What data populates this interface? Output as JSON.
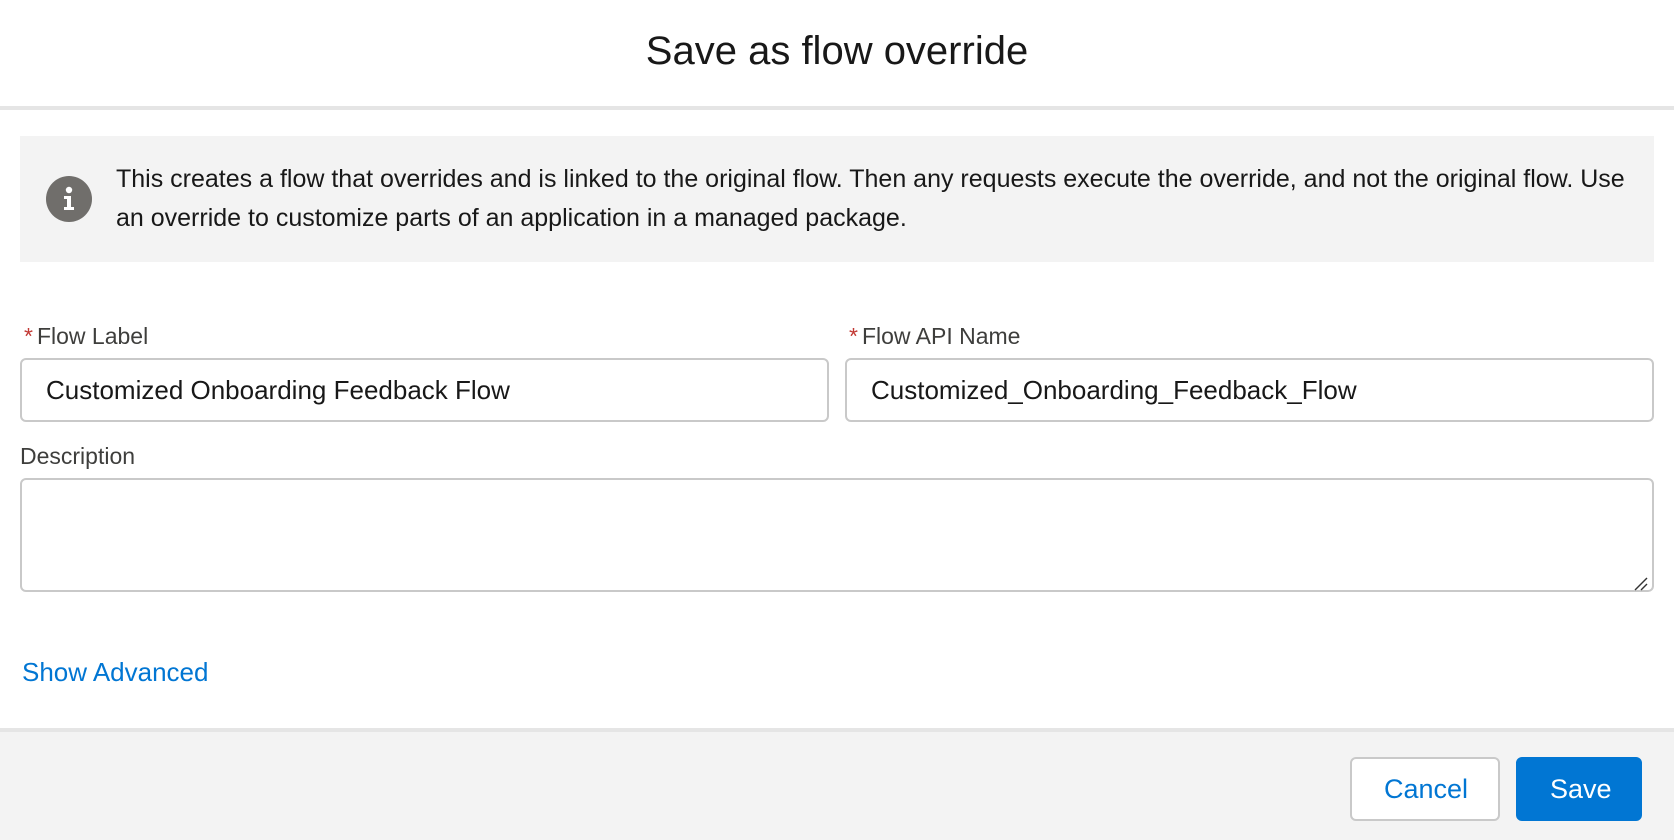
{
  "modal": {
    "title": "Save as flow override"
  },
  "info": {
    "icon": "info-icon",
    "text": "This creates a flow that overrides and is linked to the original flow. Then any requests execute the override, and not the original flow. Use an override to customize parts of an application in a managed package."
  },
  "fields": {
    "required_mark": "*",
    "flow_label": {
      "label": "Flow Label",
      "value": "Customized Onboarding Feedback Flow"
    },
    "flow_api_name": {
      "label": "Flow API Name",
      "value": "Customized_Onboarding_Feedback_Flow"
    },
    "description": {
      "label": "Description",
      "value": ""
    }
  },
  "links": {
    "show_advanced": "Show Advanced"
  },
  "footer": {
    "cancel_label": "Cancel",
    "save_label": "Save"
  },
  "colors": {
    "brand": "#0176d3",
    "required": "#c23934",
    "info_icon_bg": "#706e6b",
    "info_box_bg": "#f3f3f3"
  }
}
